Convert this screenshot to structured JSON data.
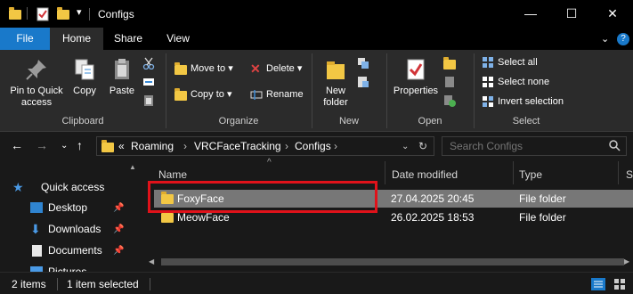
{
  "window": {
    "title": "Configs",
    "minimize": "—",
    "maximize": "☐",
    "close": "✕"
  },
  "quick_access_toolbar": {
    "dropdown": "▾"
  },
  "ribbon_tabs": {
    "file": "File",
    "home": "Home",
    "share": "Share",
    "view": "View",
    "collapse": "⌄",
    "help": "?"
  },
  "clipboard": {
    "pin_label": "Pin to Quick access",
    "copy_label": "Copy",
    "paste_label": "Paste",
    "group_label": "Clipboard"
  },
  "organize": {
    "move_to": "Move to",
    "copy_to": "Copy to",
    "delete": "Delete",
    "rename": "Rename",
    "group_label": "Organize"
  },
  "new_group": {
    "new_folder": "New folder",
    "group_label": "New"
  },
  "open_group": {
    "properties": "Properties",
    "group_label": "Open"
  },
  "select_group": {
    "select_all": "Select all",
    "select_none": "Select none",
    "invert_selection": "Invert selection",
    "group_label": "Select"
  },
  "address": {
    "overflow": "«",
    "crumbs": [
      "Roaming",
      "VRCFaceTracking",
      "Configs"
    ],
    "search_placeholder": "Search Configs"
  },
  "nav_pane": {
    "items": [
      {
        "label": "Quick access"
      },
      {
        "label": "Desktop"
      },
      {
        "label": "Downloads"
      },
      {
        "label": "Documents"
      },
      {
        "label": "Pictures"
      }
    ]
  },
  "columns": {
    "name": "Name",
    "date_modified": "Date modified",
    "type": "Type",
    "size": "S"
  },
  "files": [
    {
      "name": "FoxyFace",
      "date": "27.04.2025 20:45",
      "type": "File folder",
      "selected": true
    },
    {
      "name": "MeowFace",
      "date": "26.02.2025 18:53",
      "type": "File folder",
      "selected": false
    }
  ],
  "status": {
    "items_count": "2 items",
    "selection": "1 item selected"
  },
  "colors": {
    "file_tab": "#1979ca",
    "highlight": "#e0121a",
    "folder": "#f2c744"
  }
}
